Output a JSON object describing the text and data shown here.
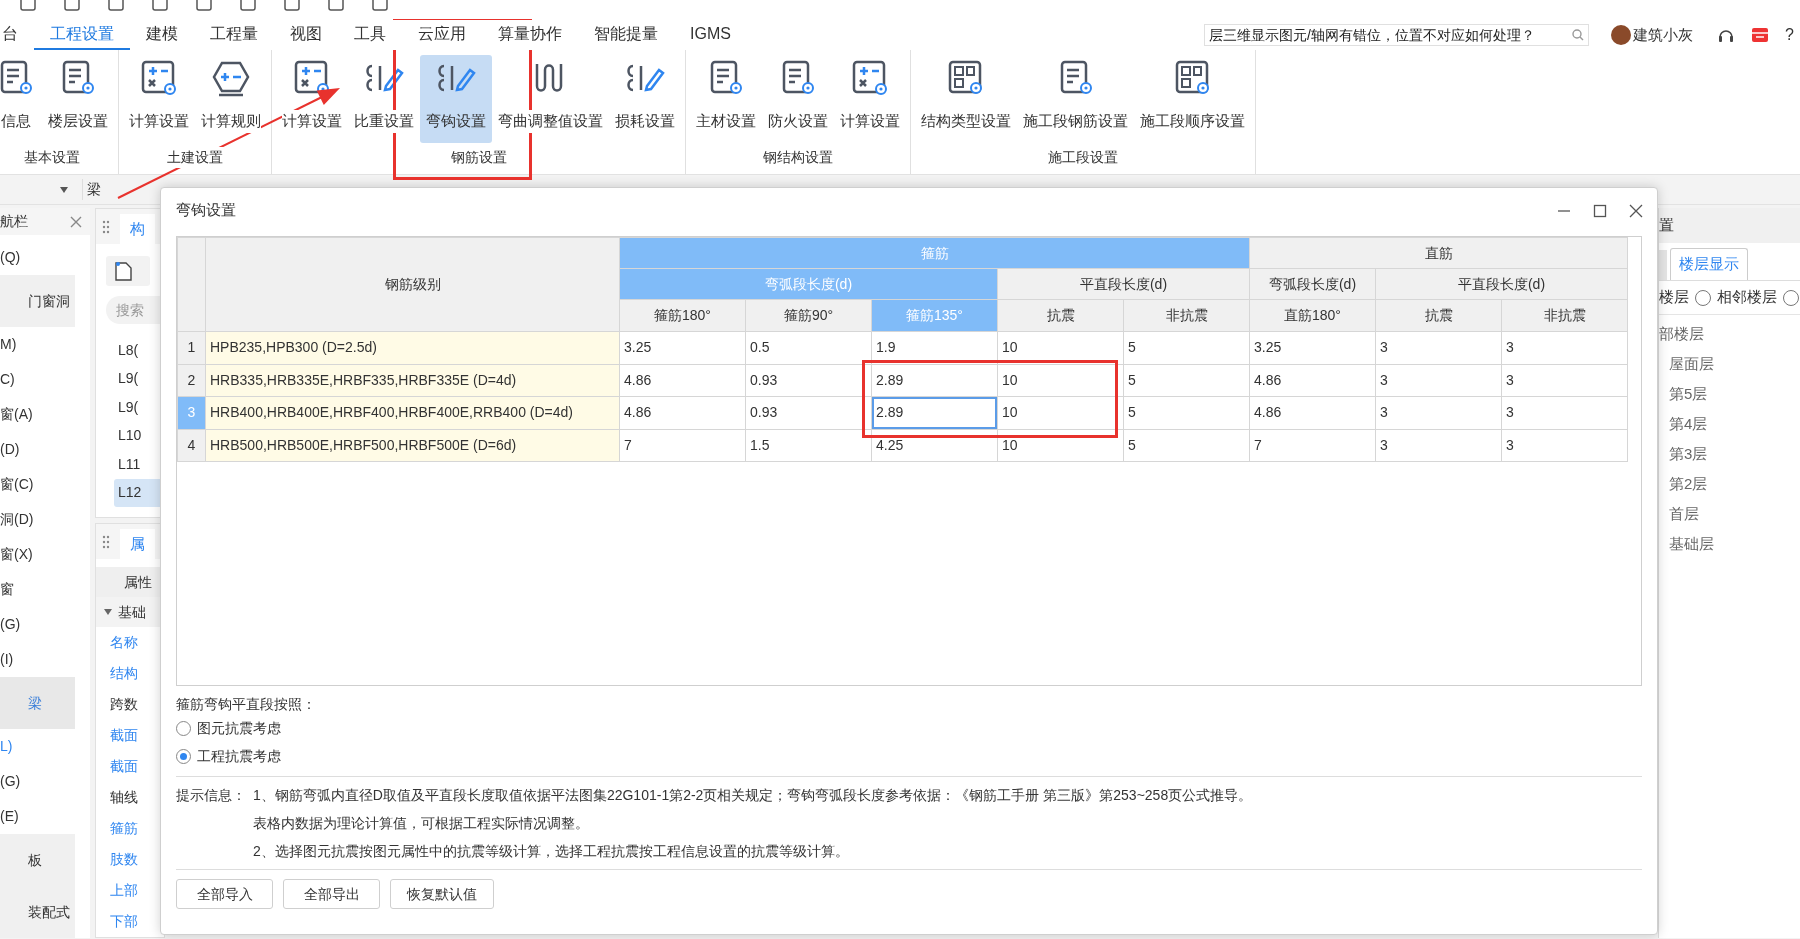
{
  "menu_tabs": [
    {
      "label": "台",
      "selected": false
    },
    {
      "label": "工程设置",
      "selected": true
    },
    {
      "label": "建模",
      "selected": false
    },
    {
      "label": "工程量",
      "selected": false
    },
    {
      "label": "视图",
      "selected": false
    },
    {
      "label": "工具",
      "selected": false
    },
    {
      "label": "云应用",
      "selected": false
    },
    {
      "label": "算量协作",
      "selected": false
    },
    {
      "label": "智能提量",
      "selected": false
    },
    {
      "label": "IGMS",
      "selected": false
    }
  ],
  "search": {
    "placeholder": "层三维显示图元/轴网有错位，位置不对应如何处理？"
  },
  "user": {
    "name": "建筑小灰"
  },
  "help": "?",
  "ribbon": [
    {
      "label": "基本设置",
      "buttons": [
        {
          "label": "信息",
          "selected": false
        },
        {
          "label": "楼层设置",
          "selected": false
        }
      ]
    },
    {
      "label": "土建设置",
      "buttons": [
        {
          "label": "计算设置",
          "selected": false
        },
        {
          "label": "计算规则",
          "selected": false
        }
      ]
    },
    {
      "label": "钢筋设置",
      "buttons": [
        {
          "label": "计算设置",
          "selected": false
        },
        {
          "label": "比重设置",
          "selected": false
        },
        {
          "label": "弯钩设置",
          "selected": true
        },
        {
          "label": "弯曲调整值设置",
          "selected": false
        },
        {
          "label": "损耗设置",
          "selected": false
        }
      ]
    },
    {
      "label": "钢结构设置",
      "buttons": [
        {
          "label": "主材设置",
          "selected": false
        },
        {
          "label": "防火设置",
          "selected": false
        },
        {
          "label": "计算设置",
          "selected": false
        }
      ]
    },
    {
      "label": "施工段设置",
      "buttons": [
        {
          "label": "结构类型设置",
          "selected": false
        },
        {
          "label": "施工段钢筋设置",
          "selected": false
        },
        {
          "label": "施工段顺序设置",
          "selected": false
        }
      ]
    }
  ],
  "toolbar": {
    "current": "梁"
  },
  "nav": {
    "title": "航栏",
    "items": [
      {
        "label": "(Q)",
        "kind": "item",
        "selected": false
      },
      {
        "label": "门窗洞",
        "kind": "group",
        "selected": false
      },
      {
        "label": "M)",
        "kind": "item",
        "selected": false
      },
      {
        "label": "C)",
        "kind": "item",
        "selected": false
      },
      {
        "label": "窗(A)",
        "kind": "item",
        "selected": false
      },
      {
        "label": "(D)",
        "kind": "item",
        "selected": false
      },
      {
        "label": "窗(C)",
        "kind": "item",
        "selected": false
      },
      {
        "label": "洞(D)",
        "kind": "item",
        "selected": false
      },
      {
        "label": "窗(X)",
        "kind": "item",
        "selected": false
      },
      {
        "label": "窗",
        "kind": "item",
        "selected": false
      },
      {
        "label": "(G)",
        "kind": "item",
        "selected": false
      },
      {
        "label": "(I)",
        "kind": "item",
        "selected": false
      },
      {
        "label": "梁",
        "kind": "group",
        "selected": true
      },
      {
        "label": "L)",
        "kind": "item",
        "selected": true
      },
      {
        "label": "(G)",
        "kind": "item",
        "selected": false
      },
      {
        "label": "(E)",
        "kind": "item",
        "selected": false
      },
      {
        "label": "板",
        "kind": "group",
        "selected": false
      },
      {
        "label": "装配式",
        "kind": "group",
        "selected": false
      }
    ]
  },
  "component_panel": {
    "tab": "构",
    "search_placeholder": "搜索",
    "items": [
      {
        "label": "L8(",
        "selected": false
      },
      {
        "label": "L9(",
        "selected": false
      },
      {
        "label": "L9(",
        "selected": false
      },
      {
        "label": "L10",
        "selected": false
      },
      {
        "label": "L11",
        "selected": false
      },
      {
        "label": "L12",
        "selected": true
      }
    ]
  },
  "property_panel": {
    "tab": "属",
    "header": "属性",
    "section": "基础",
    "rows": [
      {
        "label": "名称",
        "public": true
      },
      {
        "label": "结构",
        "public": true
      },
      {
        "label": "跨数",
        "public": false
      },
      {
        "label": "截面",
        "public": true
      },
      {
        "label": "截面",
        "public": true
      },
      {
        "label": "轴线",
        "public": false
      },
      {
        "label": "箍筋",
        "public": true
      },
      {
        "label": "肢数",
        "public": true
      },
      {
        "label": "上部",
        "public": true
      },
      {
        "label": "下部",
        "public": true
      }
    ]
  },
  "dialog": {
    "title": "弯钩设置",
    "table": {
      "corner_header": "钢筋级别",
      "header_groups": [
        {
          "label": "箍筋",
          "subgroups": [
            {
              "label": "弯弧段长度(d)",
              "columns": [
                {
                  "label": "箍筋180°",
                  "selected": false
                },
                {
                  "label": "箍筋90°",
                  "selected": false
                },
                {
                  "label": "箍筋135°",
                  "selected": true
                }
              ]
            },
            {
              "label": "平直段长度(d)",
              "columns": [
                {
                  "label": "抗震",
                  "selected": false
                },
                {
                  "label": "非抗震",
                  "selected": false
                }
              ]
            }
          ]
        },
        {
          "label": "直筋",
          "subgroups": [
            {
              "label": "弯弧段长度(d)",
              "columns": [
                {
                  "label": "直筋180°",
                  "selected": false
                }
              ]
            },
            {
              "label": "平直段长度(d)",
              "columns": [
                {
                  "label": "抗震",
                  "selected": false
                },
                {
                  "label": "非抗震",
                  "selected": false
                }
              ]
            }
          ]
        }
      ],
      "rows": [
        {
          "number": "1",
          "grade": "HPB235,HPB300 (D=2.5d)",
          "values": [
            "3.25",
            "0.5",
            "1.9",
            "10",
            "5",
            "3.25",
            "3",
            "3"
          ],
          "selected": false
        },
        {
          "number": "2",
          "grade": "HRB335,HRB335E,HRBF335,HRBF335E (D=4d)",
          "values": [
            "4.86",
            "0.93",
            "2.89",
            "10",
            "5",
            "4.86",
            "3",
            "3"
          ],
          "selected": false
        },
        {
          "number": "3",
          "grade": "HRB400,HRB400E,HRBF400,HRBF400E,RRB400 (D=4d)",
          "values": [
            "4.86",
            "0.93",
            "2.89",
            "10",
            "5",
            "4.86",
            "3",
            "3"
          ],
          "selected": true
        },
        {
          "number": "4",
          "grade": "HRB500,HRB500E,HRBF500,HRBF500E (D=6d)",
          "values": [
            "7",
            "1.5",
            "4.25",
            "10",
            "5",
            "7",
            "3",
            "3"
          ],
          "selected": false
        }
      ]
    },
    "option_label": "箍筋弯钩平直段按照：",
    "options": [
      {
        "label": "图元抗震考虑",
        "selected": false
      },
      {
        "label": "工程抗震考虑",
        "selected": true
      }
    ],
    "tips_label": "提示信息：",
    "tips": [
      "1、钢筋弯弧内直径D取值及平直段长度取值依据平法图集22G101-1第2-2页相关规定；弯钩弯弧段长度参考依据：《钢筋工手册 第三版》第253~258页公式推导。",
      "表格内数据为理论计算值，可根据工程实际情况调整。",
      "2、选择图元抗震按图元属性中的抗震等级计算，选择工程抗震按工程信息设置的抗震等级计算。"
    ],
    "buttons": [
      "全部导入",
      "全部导出",
      "恢复默认值"
    ]
  },
  "floor_panel": {
    "title": "置",
    "tabs": [
      {
        "label": "楼层显示",
        "selected": true
      }
    ],
    "scopes": [
      {
        "label": "楼层"
      },
      {
        "label": "相邻楼层",
        "selected": false
      },
      {
        "selected": false
      }
    ],
    "tree": {
      "label": "部楼层",
      "children": [
        {
          "label": "屋面层"
        },
        {
          "label": "第5层"
        },
        {
          "label": "第4层"
        },
        {
          "label": "第3层"
        },
        {
          "label": "第2层"
        },
        {
          "label": "首层"
        },
        {
          "label": "基础层"
        }
      ]
    }
  }
}
